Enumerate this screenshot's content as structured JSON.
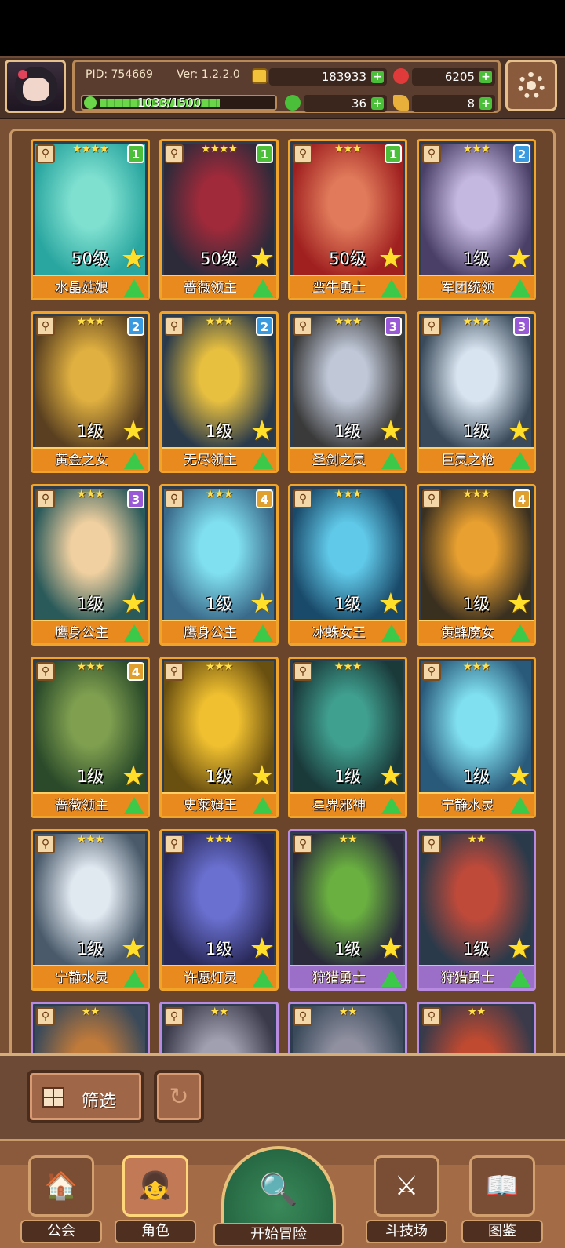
{
  "header": {
    "pid": "PID: 754669",
    "version": "Ver: 1.2.2.0",
    "gold": "183933",
    "gems": "6205",
    "clover": "36",
    "feather": "8",
    "exp": "1033/1500",
    "exp_progress": 0.689
  },
  "cards": [
    {
      "level": "50级",
      "name": "水晶菇娘",
      "stars": "★★★★",
      "rank": "1",
      "frame": "gold",
      "colors": [
        "#2aa6a0",
        "#7fe0d0"
      ]
    },
    {
      "level": "50级",
      "name": "蔷薇领主",
      "stars": "★★★★",
      "rank": "1",
      "frame": "gold",
      "colors": [
        "#2d2a3a",
        "#a02a3a"
      ]
    },
    {
      "level": "50级",
      "name": "蛮牛勇士",
      "stars": "★★★",
      "rank": "1",
      "frame": "gold",
      "colors": [
        "#a02020",
        "#e07a5a"
      ]
    },
    {
      "level": "1级",
      "name": "军团统领",
      "stars": "★★★",
      "rank": "2",
      "frame": "gold",
      "colors": [
        "#4a3f66",
        "#c4b8e0"
      ]
    },
    {
      "level": "1级",
      "name": "黄金之女",
      "stars": "★★★",
      "rank": "2",
      "frame": "gold",
      "colors": [
        "#5a4020",
        "#e0b040"
      ]
    },
    {
      "level": "1级",
      "name": "无尽领主",
      "stars": "★★★",
      "rank": "2",
      "frame": "gold",
      "colors": [
        "#2a3a4a",
        "#e8c040"
      ]
    },
    {
      "level": "1级",
      "name": "圣剑之灵",
      "stars": "★★★",
      "rank": "3",
      "frame": "gold",
      "colors": [
        "#3a3a3a",
        "#c0c8d8"
      ]
    },
    {
      "level": "1级",
      "name": "巨灵之枪",
      "stars": "★★★",
      "rank": "3",
      "frame": "gold",
      "colors": [
        "#3a4a5a",
        "#d8e4f0"
      ]
    },
    {
      "level": "1级",
      "name": "鹰身公主",
      "stars": "★★★",
      "rank": "3",
      "frame": "gold",
      "colors": [
        "#2a5a5a",
        "#f0d0a0"
      ]
    },
    {
      "level": "1级",
      "name": "鹰身公主",
      "stars": "★★★",
      "rank": "4",
      "frame": "gold",
      "colors": [
        "#3a6a8a",
        "#80e0f0"
      ]
    },
    {
      "level": "1级",
      "name": "冰蛛女王",
      "stars": "★★★",
      "rank": "",
      "frame": "gold",
      "colors": [
        "#1a4a6a",
        "#60c8e8"
      ]
    },
    {
      "level": "1级",
      "name": "黄蜂魔女",
      "stars": "★★★",
      "rank": "4",
      "frame": "gold",
      "colors": [
        "#3a3020",
        "#e8a030"
      ]
    },
    {
      "level": "1级",
      "name": "蔷薇领主",
      "stars": "★★★",
      "rank": "4",
      "frame": "gold",
      "colors": [
        "#2a4a2a",
        "#80a050"
      ]
    },
    {
      "level": "1级",
      "name": "史莱姆王",
      "stars": "★★★",
      "rank": "",
      "frame": "gold",
      "colors": [
        "#6a5010",
        "#f0c030"
      ]
    },
    {
      "level": "1级",
      "name": "星界邪神",
      "stars": "★★★",
      "rank": "",
      "frame": "gold",
      "colors": [
        "#1a3a3a",
        "#40a090"
      ]
    },
    {
      "level": "1级",
      "name": "宁静水灵",
      "stars": "★★★",
      "rank": "",
      "frame": "gold",
      "colors": [
        "#2a5a7a",
        "#80e0f0"
      ]
    },
    {
      "level": "1级",
      "name": "宁静水灵",
      "stars": "★★★",
      "rank": "",
      "frame": "gold",
      "colors": [
        "#4a5a6a",
        "#e0e8f0"
      ]
    },
    {
      "level": "1级",
      "name": "许愿灯灵",
      "stars": "★★★",
      "rank": "",
      "frame": "gold",
      "colors": [
        "#2a2a5a",
        "#6a70d0"
      ]
    },
    {
      "level": "1级",
      "name": "狩猎勇士",
      "stars": "★★",
      "rank": "",
      "frame": "purple",
      "colors": [
        "#2a2a3a",
        "#6ab040"
      ]
    },
    {
      "level": "1级",
      "name": "狩猎勇士",
      "stars": "★★",
      "rank": "",
      "frame": "purple",
      "colors": [
        "#2a3a4a",
        "#c04a3a"
      ]
    },
    {
      "level": "",
      "name": "",
      "stars": "★★",
      "rank": "",
      "frame": "purple",
      "colors": [
        "#3a4a5a",
        "#c07a3a"
      ]
    },
    {
      "level": "",
      "name": "",
      "stars": "★★",
      "rank": "",
      "frame": "purple",
      "colors": [
        "#3a3a4a",
        "#a0a0b0"
      ]
    },
    {
      "level": "",
      "name": "",
      "stars": "★★",
      "rank": "",
      "frame": "purple",
      "colors": [
        "#3a4a5a",
        "#9090a0"
      ]
    },
    {
      "level": "",
      "name": "",
      "stars": "★★",
      "rank": "",
      "frame": "purple",
      "colors": [
        "#3a3a4a",
        "#c04a30"
      ]
    }
  ],
  "controls": {
    "filter_label": "筛选",
    "refresh_glyph": "↻"
  },
  "nav": {
    "guild": "公会",
    "character": "角色",
    "adventure": "开始冒险",
    "arena": "斗技场",
    "codex": "图鉴"
  },
  "icons": [
    "portrait-avatar",
    "gold-coin-icon",
    "gem-icon",
    "clover-icon",
    "feather-icon",
    "settings-gear-icon",
    "filter-grid-icon",
    "refresh-icon",
    "guild-icon",
    "character-icon",
    "adventure-map-icon",
    "arena-swords-icon",
    "codex-book-icon"
  ]
}
